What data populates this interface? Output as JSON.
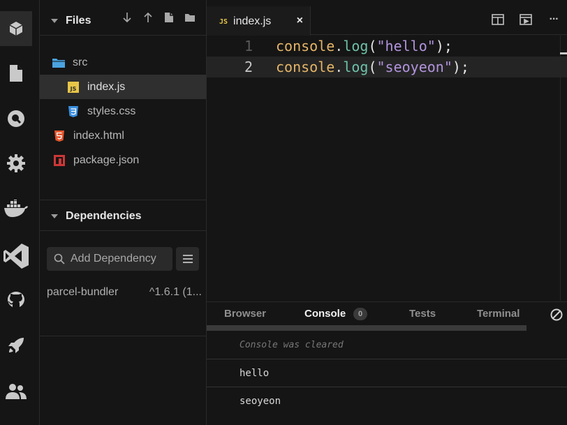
{
  "activity_bar": {
    "items": [
      {
        "icon": "cube-icon",
        "active": true
      },
      {
        "icon": "file-icon",
        "active": false
      },
      {
        "icon": "search-icon",
        "active": false
      },
      {
        "icon": "gear-icon",
        "active": false
      },
      {
        "icon": "docker-icon",
        "active": false
      },
      {
        "icon": "vscode-icon",
        "active": false
      },
      {
        "icon": "github-icon",
        "active": false
      },
      {
        "icon": "rocket-icon",
        "active": false
      },
      {
        "icon": "users-icon",
        "active": false
      }
    ]
  },
  "files": {
    "title": "Files",
    "actions": [
      "download-icon",
      "upload-icon",
      "new-file-icon",
      "new-folder-icon"
    ],
    "tree": [
      {
        "name": "src",
        "icon": "folder-icon",
        "color": "#4aa3df"
      },
      {
        "name": "index.js",
        "icon": "js-file-icon",
        "color": "#e7c547",
        "selected": true
      },
      {
        "name": "styles.css",
        "icon": "css-file-icon",
        "color": "#3b8fe0"
      },
      {
        "name": "index.html",
        "icon": "html-file-icon",
        "color": "#e4572e"
      },
      {
        "name": "package.json",
        "icon": "npm-file-icon",
        "color": "#cb3837"
      }
    ]
  },
  "dependencies": {
    "title": "Dependencies",
    "add_placeholder": "Add Dependency",
    "items": [
      {
        "name": "parcel-bundler",
        "version": "^1.6.1 (1..."
      }
    ]
  },
  "editor": {
    "tab": {
      "label": "index.js",
      "badge": "JS",
      "close": "×"
    },
    "lines": [
      {
        "number": "1",
        "object": "console",
        "dot": ".",
        "method": "log",
        "open": "(",
        "string": "\"hello\"",
        "close": ");"
      },
      {
        "number": "2",
        "object": "console",
        "dot": ".",
        "method": "log",
        "open": "(",
        "string": "\"seoyeon\"",
        "close": ");"
      }
    ],
    "tools": [
      "split-view-icon",
      "preview-icon",
      "more-icon"
    ],
    "more_label": "···"
  },
  "panel": {
    "tabs": [
      "Browser",
      "Console",
      "Tests",
      "Terminal"
    ],
    "active_tab": "Console",
    "console_count": "0",
    "logs": {
      "cleared": "Console was cleared",
      "messages": [
        "hello",
        "seoyeon"
      ]
    }
  },
  "colors": {
    "background": "#151515",
    "selection": "#2f2f2f",
    "keyword_object": "#e5b567",
    "method": "#6fc1a8",
    "string": "#b294dd"
  }
}
